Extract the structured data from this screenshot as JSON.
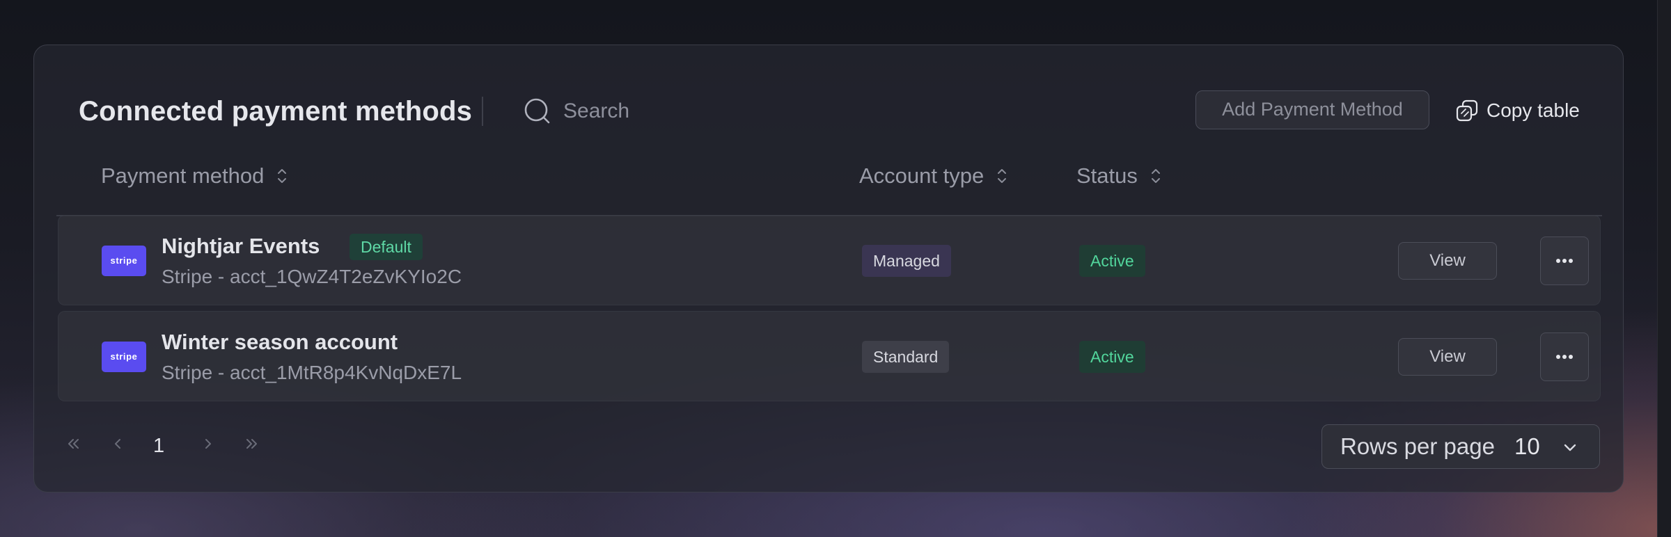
{
  "card": {
    "title": "Connected payment methods",
    "search": {
      "placeholder": "Search",
      "value": ""
    },
    "add_button_label": "Add Payment Method",
    "copy_button_label": "Copy table"
  },
  "table": {
    "columns": [
      {
        "label": "Payment method",
        "sortable": true
      },
      {
        "label": "Account type",
        "sortable": true
      },
      {
        "label": "Status",
        "sortable": true
      }
    ],
    "rows": [
      {
        "logo_text": "stripe",
        "name": "Nightjar Events",
        "badge": "Default",
        "subtitle": "Stripe - acct_1QwZ4T2eZvKYIo2C",
        "account_type": "Managed",
        "status": "Active",
        "view_label": "View"
      },
      {
        "logo_text": "stripe",
        "name": "Winter season account",
        "badge": "",
        "subtitle": "Stripe - acct_1MtR8p4KvNqDxE7L",
        "account_type": "Standard",
        "status": "Active",
        "view_label": "View"
      }
    ]
  },
  "pagination": {
    "current_page": "1",
    "rows_per_page_label": "Rows per page",
    "rows_per_page_value": "10"
  },
  "colors": {
    "stripe_brand": "#5a4cf0",
    "status_active": "#52d69c",
    "default_badge": "#5fd9a6"
  },
  "icons": {
    "search": "search-icon",
    "copy": "copy-icon",
    "sort": "sort-updown-icon",
    "more": "more-horizontal-icon",
    "first": "chevrons-left-icon",
    "prev": "chevron-left-icon",
    "next": "chevron-right-icon",
    "last": "chevrons-right-icon",
    "dropdown": "chevron-down-icon"
  }
}
